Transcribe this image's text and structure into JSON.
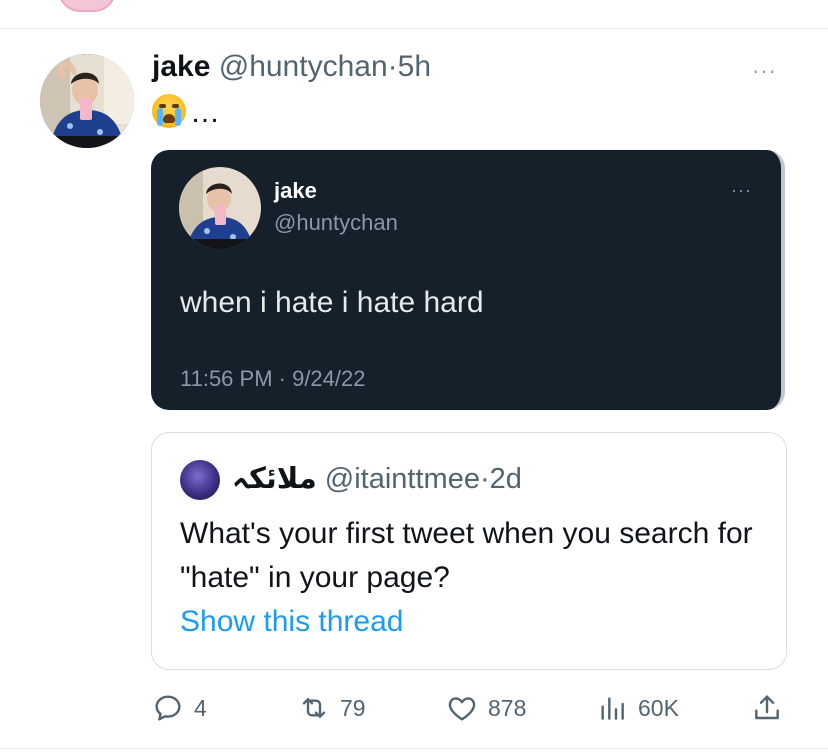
{
  "tweet": {
    "author_name": "jake",
    "handle": "@huntychan",
    "separator": "·",
    "time": "5h",
    "text": "…",
    "emoji_icon": "loudly-crying-face-icon"
  },
  "screenshot_card": {
    "name": "jake",
    "handle": "@huntychan",
    "text": "when i hate i hate hard",
    "timestamp": "11:56 PM · 9/24/22",
    "more_label": "···"
  },
  "quoted_tweet": {
    "author_name": "ملائكہ",
    "handle": "@itainttmee",
    "separator": "·",
    "time": "2d",
    "text": "What's your first tweet when you search for \"hate\" in your page?",
    "link": "Show this thread"
  },
  "more_label": "···",
  "actions": {
    "replies": "4",
    "retweets": "79",
    "likes": "878",
    "views": "60K"
  },
  "colors": {
    "text_primary": "#0f1419",
    "text_secondary": "#536471",
    "link": "#1d9bf0",
    "dark_card_bg": "#15202b",
    "divider": "#e6e9ec"
  }
}
